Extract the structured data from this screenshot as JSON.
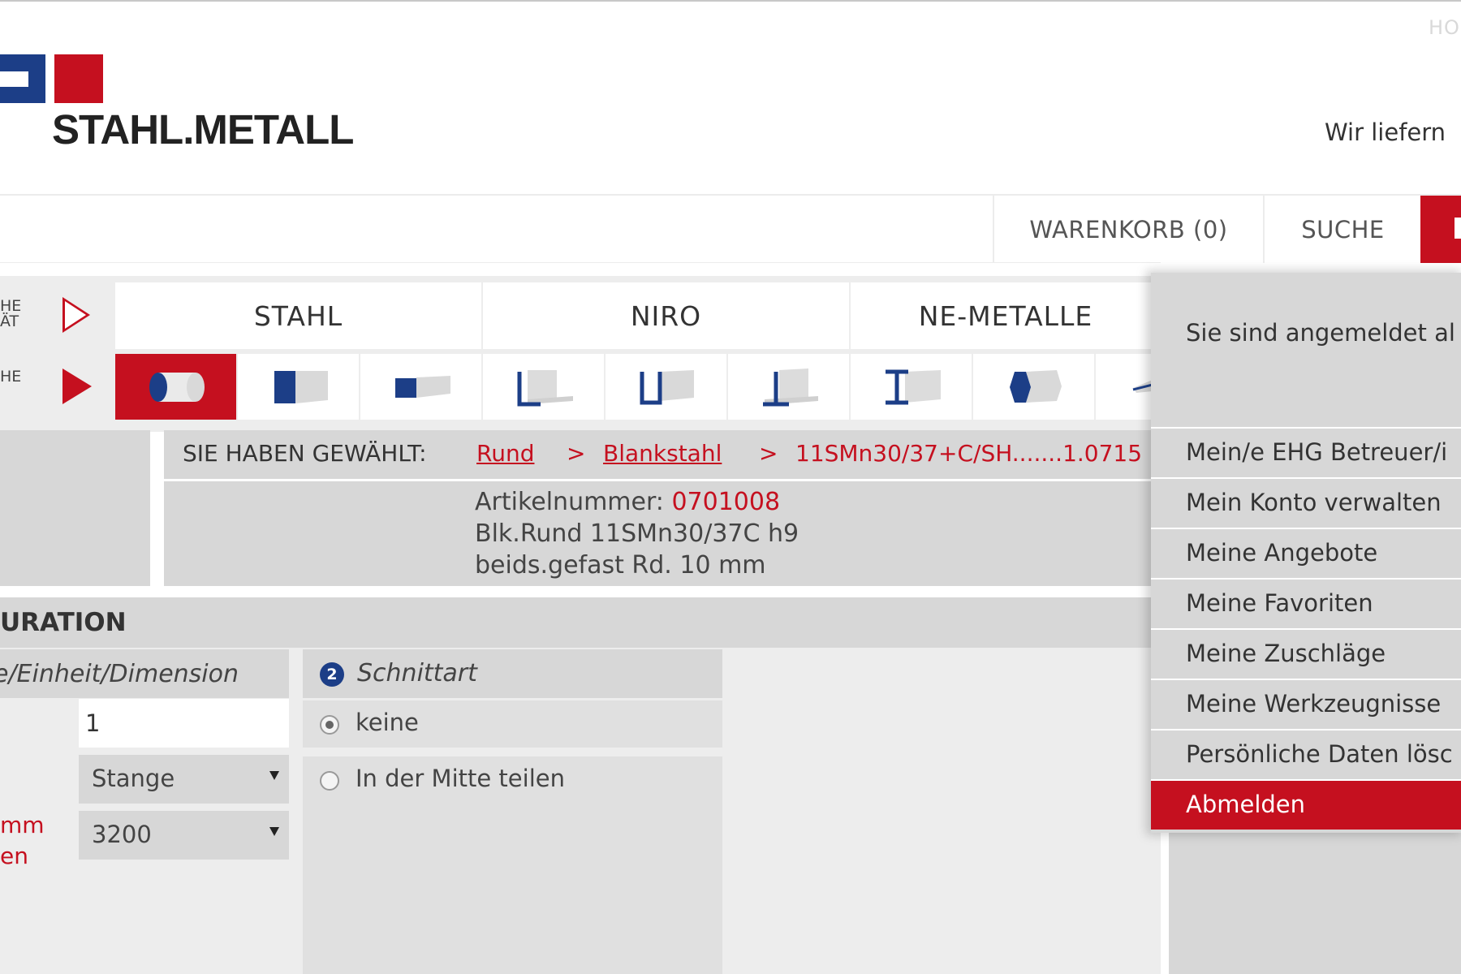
{
  "header": {
    "top_link": "HO",
    "logo_text": "STAHL.METALL",
    "slogan": "Wir liefern"
  },
  "nav": {
    "cart": "WARENKORB (0)",
    "search": "SUCHE"
  },
  "side_labels": {
    "row1": [
      "HE",
      "ÄT"
    ],
    "row2": [
      "HE"
    ]
  },
  "material_tabs": [
    "STAHL",
    "NIRO",
    "NE-METALLE"
  ],
  "shape_icons": [
    "round-bar-icon",
    "square-bar-icon",
    "flat-bar-icon",
    "angle-profile-icon",
    "u-channel-icon",
    "t-profile-icon",
    "i-beam-icon",
    "hexagon-bar-icon",
    "sheet-icon"
  ],
  "selection": {
    "label": "SIE HABEN GEWÄHLT:",
    "crumb1": "Rund",
    "sep": ">",
    "crumb2": "Blankstahl",
    "crumb3": "11SMn30/37+C/SH.......1.0715"
  },
  "article": {
    "number_label": "Artikelnummer: ",
    "number": "0701008",
    "line2": "Blk.Rund 11SMn30/37C h9",
    "line3": "beids.gefast Rd. 10 mm"
  },
  "konfiguration": {
    "title": "URATION",
    "col1_head": "e/Einheit/Dimension",
    "quantity": "1",
    "unit": "Stange",
    "length": "3200",
    "red_note": [
      "mm",
      "en"
    ],
    "col2_step": "2",
    "col2_head": "Schnittart",
    "options": [
      "keine",
      "In der Mitte teilen"
    ],
    "selected_option": 0
  },
  "account_menu": {
    "info": "Sie sind angemeldet al",
    "items": [
      "Mein/e EHG Betreuer/i",
      "Mein Konto verwalten",
      "Meine Angebote",
      "Meine Favoriten",
      "Meine Zuschläge",
      "Meine Werkzeugnisse",
      "Persönliche Daten lösc"
    ],
    "logout": "Abmelden"
  },
  "colors": {
    "brand_red": "#c5101f",
    "brand_blue": "#1c3e87",
    "panel_gray": "#d7d7d7"
  }
}
